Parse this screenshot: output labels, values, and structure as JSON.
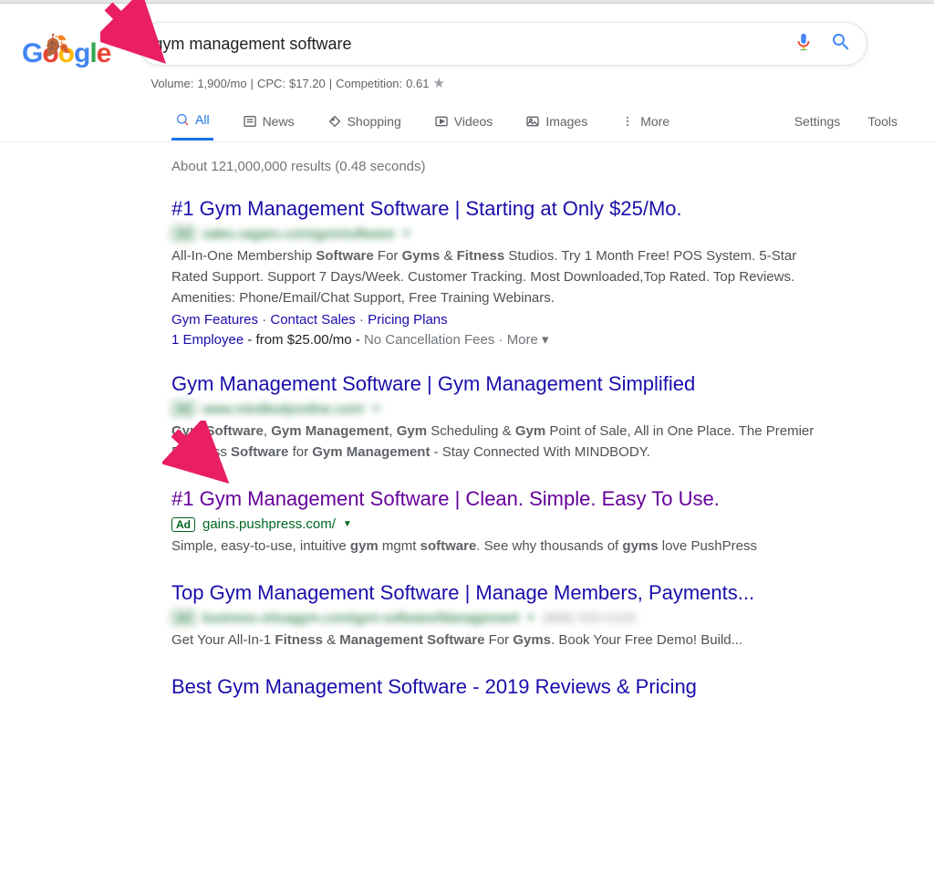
{
  "logo": {
    "g1": "G",
    "o1": "o",
    "o2": "o",
    "g2": "g",
    "l": "l",
    "e": "e"
  },
  "search": {
    "query": "gym management software"
  },
  "seo_stats": {
    "volume_label": "Volume:",
    "volume": "1,900/mo",
    "cpc_label": "CPC:",
    "cpc": "$17.20",
    "comp_label": "Competition:",
    "comp": "0.61",
    "sep": " | "
  },
  "tabs": {
    "all": "All",
    "news": "News",
    "shopping": "Shopping",
    "videos": "Videos",
    "images": "Images",
    "more": "More",
    "settings": "Settings",
    "tools": "Tools"
  },
  "result_stats": "About 121,000,000 results (0.48 seconds)",
  "results": [
    {
      "title": "#1 Gym Management Software | Starting at Only $25/Mo.",
      "visited": false,
      "ad": true,
      "url": "sales.vagaro.com/gym/software",
      "url_blurred": true,
      "snippet_html": "All-In-One Membership <b>Software</b> For <b>Gyms</b> & <b>Fitness</b> Studios. Try 1 Month Free! POS System. 5-Star Rated Support. Support 7 Days/Week. Customer Tracking. Most Downloaded,Top Rated. Top Reviews. Amenities: Phone/Email/Chat Support, Free Training Webinars.",
      "sitelinks": [
        "Gym Features",
        "Contact Sales",
        "Pricing Plans"
      ],
      "offer": {
        "link": "1 Employee",
        "mid": " - from $25.00/mo - ",
        "gray": "No Cancellation Fees",
        "more": " · More ▾"
      }
    },
    {
      "title": "Gym Management Software | Gym Management Simplified",
      "visited": false,
      "ad": true,
      "url": "www.mindbodyonline.com/",
      "url_blurred": true,
      "snippet_html": "<b>Gym Software</b>, <b>Gym Management</b>, <b>Gym</b> Scheduling & <b>Gym</b> Point of Sale, All in One Place. The Premier Business <b>Software</b> for <b>Gym Management</b> - Stay Connected With MINDBODY."
    },
    {
      "title": "#1 Gym Management Software | Clean. Simple. Easy To Use.",
      "visited": true,
      "ad": true,
      "url": "gains.pushpress.com/",
      "url_blurred": false,
      "snippet_html": "Simple, easy-to-use, intuitive <b>gym</b> mgmt <b>software</b>. See why thousands of <b>gyms</b> love PushPress"
    },
    {
      "title": "Top Gym Management Software | Manage Members, Payments...",
      "visited": false,
      "ad": true,
      "url": "business.virtuagym.com/gym-software/Management",
      "url_blurred": true,
      "snippet_html": "Get Your All-In-1 <b>Fitness</b> & <b>Management Software</b> For <b>Gyms</b>. Book Your Free Demo! Build..."
    },
    {
      "title": "Best Gym Management Software - 2019 Reviews & Pricing",
      "visited": false,
      "ad": false,
      "url": "",
      "url_blurred": false,
      "snippet_html": ""
    }
  ],
  "annotations": {
    "arrow_color": "#e91e63"
  }
}
